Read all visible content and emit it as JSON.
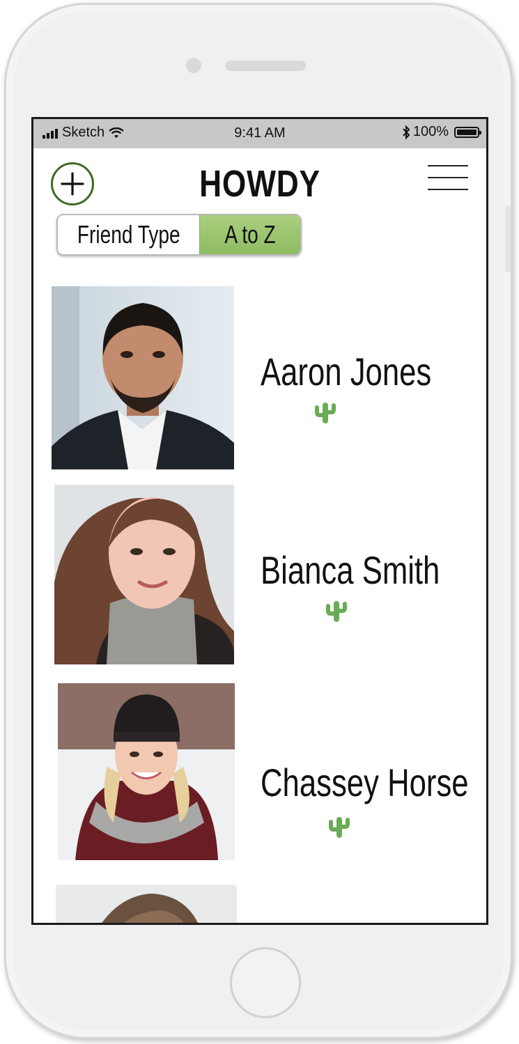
{
  "status_bar": {
    "carrier": "Sketch",
    "time": "9:41 AM",
    "battery": "100%",
    "icons": [
      "signal-icon",
      "wifi-icon",
      "bluetooth-icon",
      "battery-icon"
    ]
  },
  "header": {
    "title": "HOWDY",
    "add_icon": "plus-circle-icon",
    "menu_icon": "hamburger-menu-icon"
  },
  "sort_toggle": {
    "options": [
      "Friend Type",
      "A to Z"
    ],
    "selected": "A to Z"
  },
  "friends": [
    {
      "name": "Aaron Jones",
      "badge_icon": "cactus-icon"
    },
    {
      "name": "Bianca Smith",
      "badge_icon": "cactus-icon"
    },
    {
      "name": "Chassey Horse",
      "badge_icon": "cactus-icon"
    }
  ],
  "colors": {
    "accent_green": "#8fbb62",
    "cactus_green": "#6aac55",
    "add_button_border": "#3f6b24",
    "status_bar_bg": "#c8c8c8"
  }
}
